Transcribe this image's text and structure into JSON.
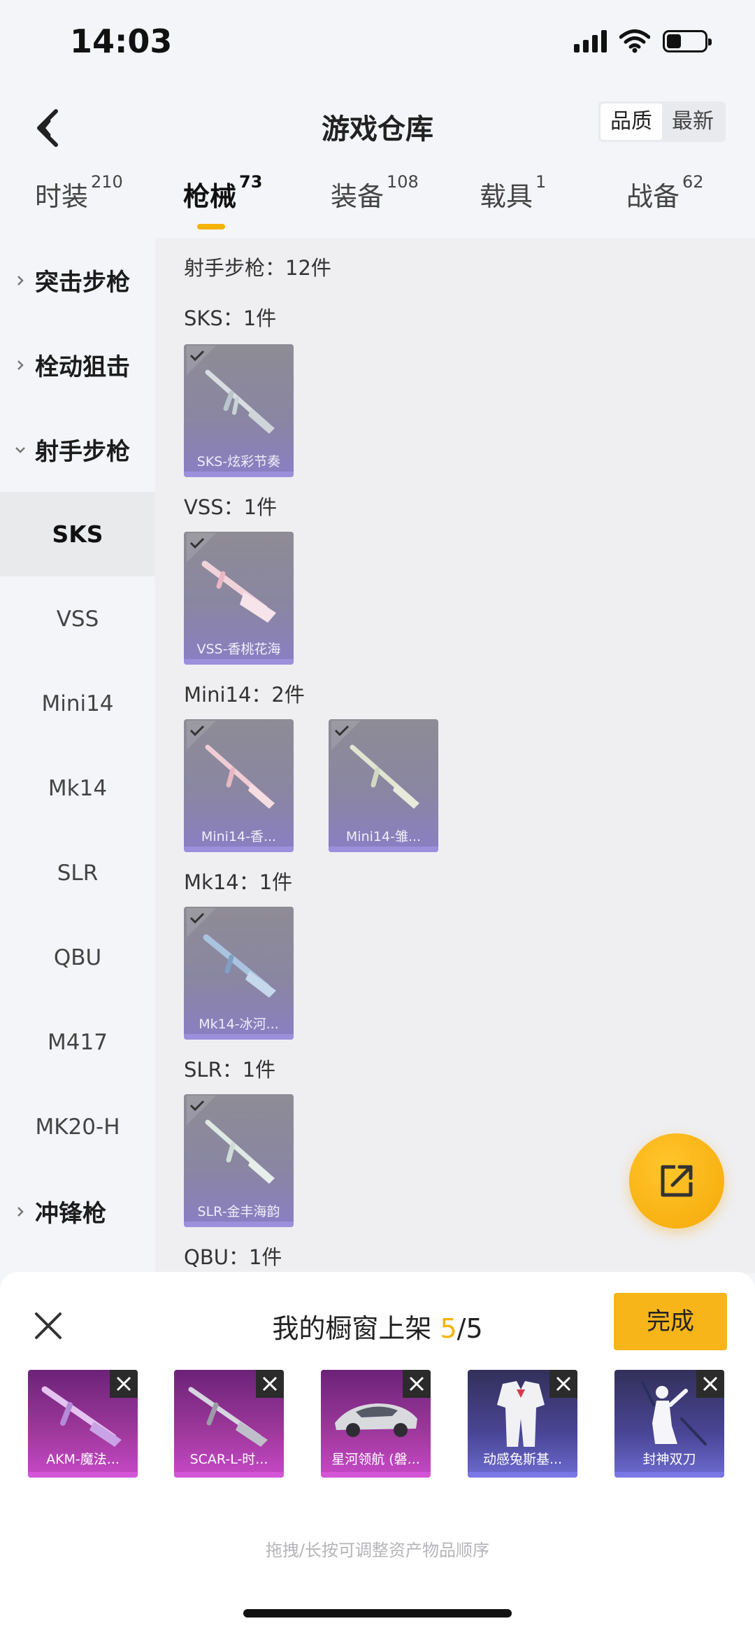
{
  "status": {
    "time": "14:03"
  },
  "header": {
    "title": "游戏仓库",
    "sort": [
      "品质",
      "最新"
    ]
  },
  "tabs": [
    {
      "label": "时装",
      "count": "210"
    },
    {
      "label": "枪械",
      "count": "73"
    },
    {
      "label": "装备",
      "count": "108"
    },
    {
      "label": "载具",
      "count": "1"
    },
    {
      "label": "战备",
      "count": "62"
    }
  ],
  "sidebar": {
    "items": [
      {
        "label": "突击步枪"
      },
      {
        "label": "栓动狙击"
      },
      {
        "label": "射手步枪"
      },
      {
        "label": "SKS"
      },
      {
        "label": "VSS"
      },
      {
        "label": "Mini14"
      },
      {
        "label": "Mk14"
      },
      {
        "label": "SLR"
      },
      {
        "label": "QBU"
      },
      {
        "label": "M417"
      },
      {
        "label": "MK20-H"
      },
      {
        "label": "冲锋枪"
      }
    ]
  },
  "content": {
    "header": "射手步枪：12件",
    "sections": [
      {
        "label": "SKS：1件",
        "cards": [
          "SKS-炫彩节奏"
        ]
      },
      {
        "label": "VSS：1件",
        "cards": [
          "VSS-香桃花海"
        ]
      },
      {
        "label": "Mini14：2件",
        "cards": [
          "Mini14-香...",
          "Mini14-雏..."
        ]
      },
      {
        "label": "Mk14：1件",
        "cards": [
          "Mk14-冰河..."
        ]
      },
      {
        "label": "SLR：1件",
        "cards": [
          "SLR-金丰海韵"
        ]
      },
      {
        "label": "QBU：1件"
      }
    ]
  },
  "sheet": {
    "title_prefix": "我的橱窗上架 ",
    "count": "5",
    "total": "/5",
    "done_label": "完成",
    "items": [
      {
        "name": "AKM-魔法...",
        "kind": "weapon"
      },
      {
        "name": "SCAR-L-时...",
        "kind": "weapon"
      },
      {
        "name": "星河领航 (磐...",
        "kind": "weapon"
      },
      {
        "name": "动感兔斯基...",
        "kind": "outfit"
      },
      {
        "name": "封神双刀",
        "kind": "outfit"
      }
    ],
    "hint": "拖拽/长按可调整资产物品顺序"
  },
  "colors": {
    "accent": "#f5b20a",
    "card_weapon": "#a1399e",
    "card_outfit": "#4a4697",
    "card_gray": "#8a86a2"
  }
}
